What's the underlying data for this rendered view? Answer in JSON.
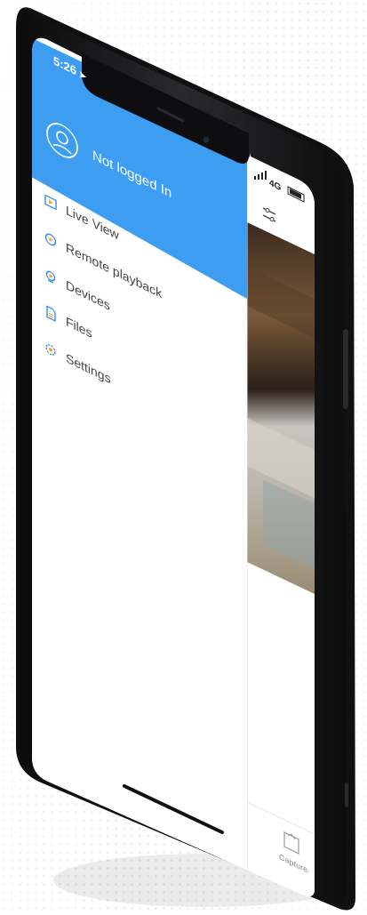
{
  "status_bar": {
    "time": "5:26",
    "signal_label": "4G"
  },
  "drawer": {
    "user_label": "Not logged In",
    "items": [
      {
        "label": "Live View",
        "icon": "live-view-icon"
      },
      {
        "label": "Remote playback",
        "icon": "playback-icon"
      },
      {
        "label": "Devices",
        "icon": "devices-icon"
      },
      {
        "label": "Files",
        "icon": "files-icon"
      },
      {
        "label": "Settings",
        "icon": "settings-icon"
      }
    ]
  },
  "main": {
    "capture_label": "Capture"
  },
  "colors": {
    "header_blue": "#3d9df0",
    "icon_blue": "#2e8ef0",
    "icon_orange": "#f5a623",
    "frame": "#1c1c1e"
  }
}
